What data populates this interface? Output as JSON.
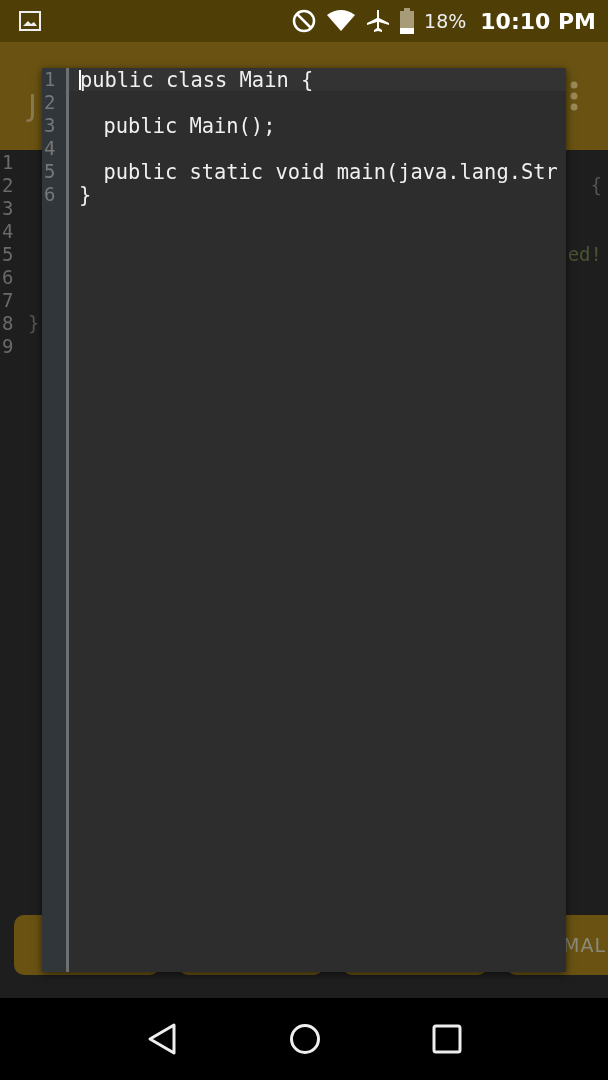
{
  "status_bar": {
    "battery": "18%",
    "time": "10:10 PM"
  },
  "app_bar": {
    "title": "J"
  },
  "editor": {
    "lines": [
      {
        "number": "1"
      },
      {
        "number": "2",
        "right": "{"
      },
      {
        "number": "3"
      },
      {
        "number": "4"
      },
      {
        "number": "5",
        "right": "ed!"
      },
      {
        "number": "6"
      },
      {
        "number": "7"
      },
      {
        "number": "8",
        "left": "}"
      },
      {
        "number": "9"
      }
    ]
  },
  "buttons": [
    {
      "kind": "blank"
    },
    {
      "kind": "blank"
    },
    {
      "kind": "blank"
    },
    {
      "kind": "text",
      "label": "MAL"
    }
  ],
  "popup": {
    "lines": [
      {
        "number": "1",
        "text": "public class Main {",
        "current": true
      },
      {
        "number": "2",
        "current": false
      },
      {
        "number": "3",
        "text": "  public Main();",
        "current": false
      },
      {
        "number": "4",
        "current": false
      },
      {
        "number": "5",
        "text": "  public static void main(java.lang.Str",
        "current": false
      },
      {
        "number": "6",
        "text": "}",
        "current": false
      }
    ]
  }
}
